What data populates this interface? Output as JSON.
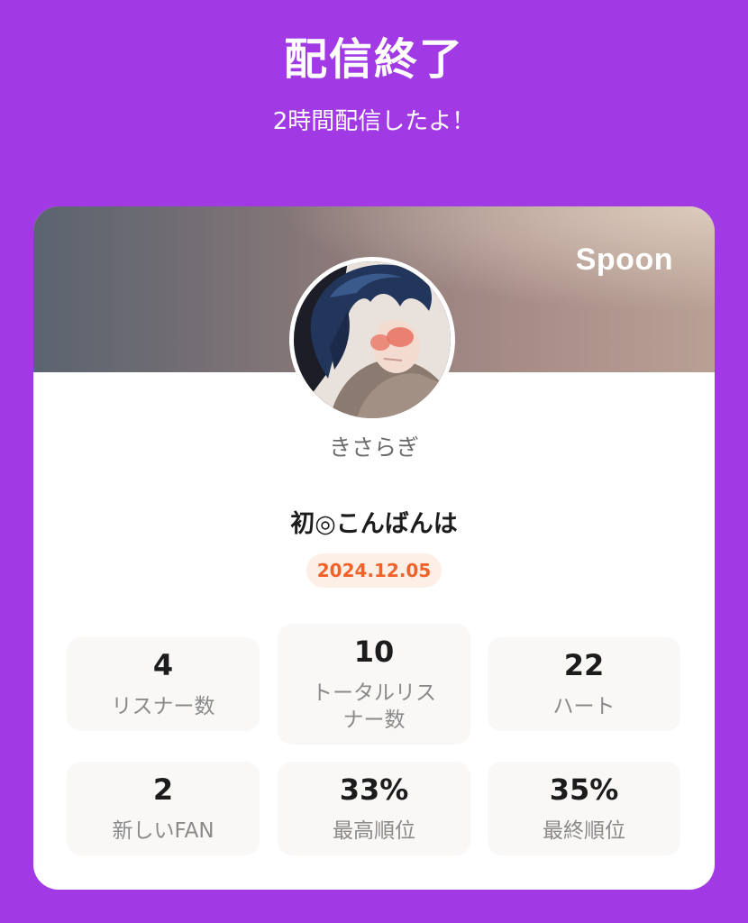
{
  "header": {
    "title": "配信終了",
    "subtitle": "2時間配信したよ！"
  },
  "card": {
    "brand": "Spoon",
    "username": "きさらぎ",
    "stream_title": "初◎こんばんは",
    "date": "2024.12.05",
    "stats": [
      {
        "value": "4",
        "label": "リスナー数"
      },
      {
        "value": "10",
        "label": "トータルリスナー数"
      },
      {
        "value": "22",
        "label": "ハート"
      },
      {
        "value": "2",
        "label": "新しいFAN"
      },
      {
        "value": "33%",
        "label": "最高順位"
      },
      {
        "value": "35%",
        "label": "最終順位"
      }
    ]
  },
  "colors": {
    "background": "#a13ae4",
    "date_badge_text": "#f0622a",
    "date_badge_bg": "#fdeee6"
  },
  "icons": {
    "avatar": "anime-character-avatar"
  }
}
